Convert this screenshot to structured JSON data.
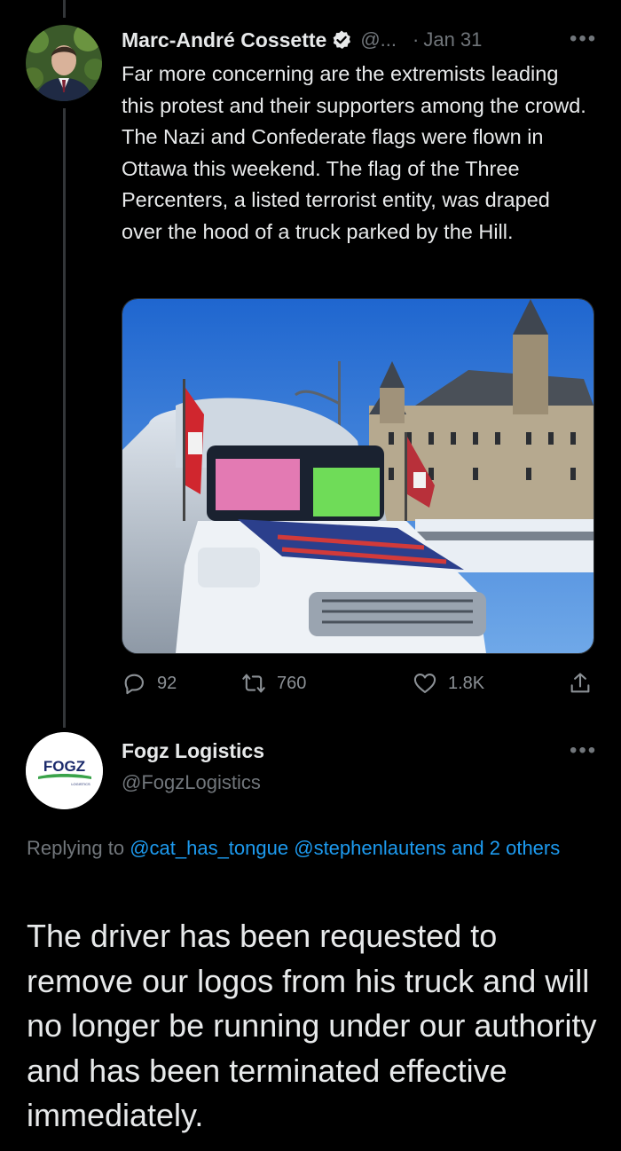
{
  "tweet1": {
    "author_name": "Marc-André Cossette",
    "handle_truncated": "@...",
    "date_sep": "·",
    "date": "Jan 31",
    "more": "•••",
    "text": "Far more concerning are the extremists leading this protest and their supporters among the crowd. The Nazi and Confederate flags were flown in Ottawa this weekend. The flag of the Three Percenters, a listed terrorist entity, was draped over the hood of a truck parked by the Hill.",
    "replies": "92",
    "retweets": "760",
    "likes": "1.8K",
    "icons": [
      "reply-icon",
      "retweet-icon",
      "like-icon",
      "share-icon",
      "verified-badge-icon"
    ]
  },
  "tweet2": {
    "author_name": "Fogz Logistics",
    "handle": "@FogzLogistics",
    "more": "•••",
    "avatar_logo_text": "FOGZ",
    "avatar_logo_subtext": "LOGISTICS",
    "replying_prefix": "Replying to ",
    "replying_users": [
      "@cat_has_tongue",
      "@stephenlautens"
    ],
    "replying_others": "and 2 others",
    "text": "The driver has been requested to remove our logos from his truck and will no longer be running under our authority and has been terminated effective immediately."
  },
  "colors": {
    "background": "#000000",
    "text": "#e7e9ea",
    "muted": "#71767b",
    "link": "#1d9bf0"
  }
}
